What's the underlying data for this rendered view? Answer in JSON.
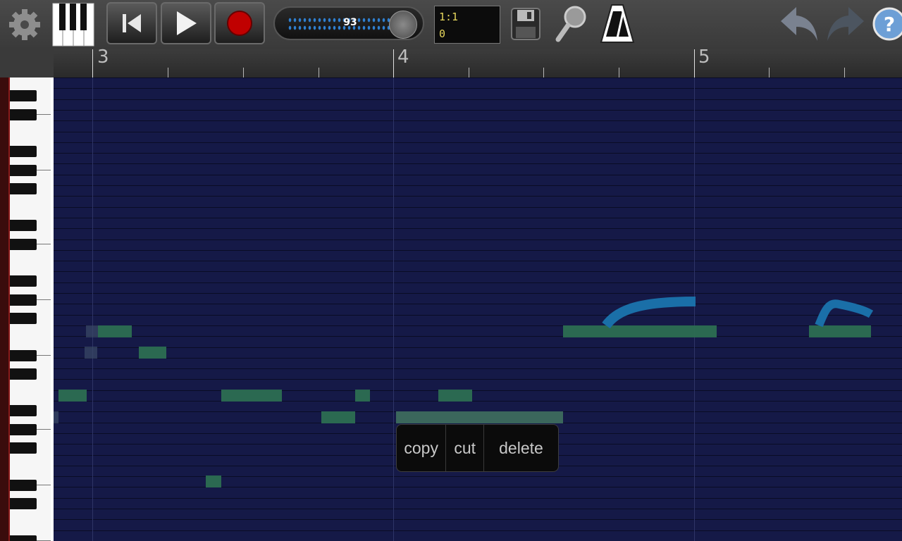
{
  "toolbar": {
    "tempo_value": "93",
    "position_line1": "1:1",
    "position_line2": "0",
    "icons": [
      "gear-icon",
      "piano-icon",
      "skip-to-start-icon",
      "play-icon",
      "record-icon",
      "save-icon",
      "zoom-icon",
      "metronome-icon",
      "undo-icon",
      "redo-icon",
      "help-icon"
    ]
  },
  "ruler": {
    "bars": [
      "3",
      "4",
      "5"
    ]
  },
  "context_menu": {
    "copy": "copy",
    "cut": "cut",
    "delete": "delete"
  },
  "colors": {
    "grid_background": "#151947",
    "note": "#2c6e52",
    "pitch_bend": "#1a6fa8",
    "record": "#c00000"
  }
}
